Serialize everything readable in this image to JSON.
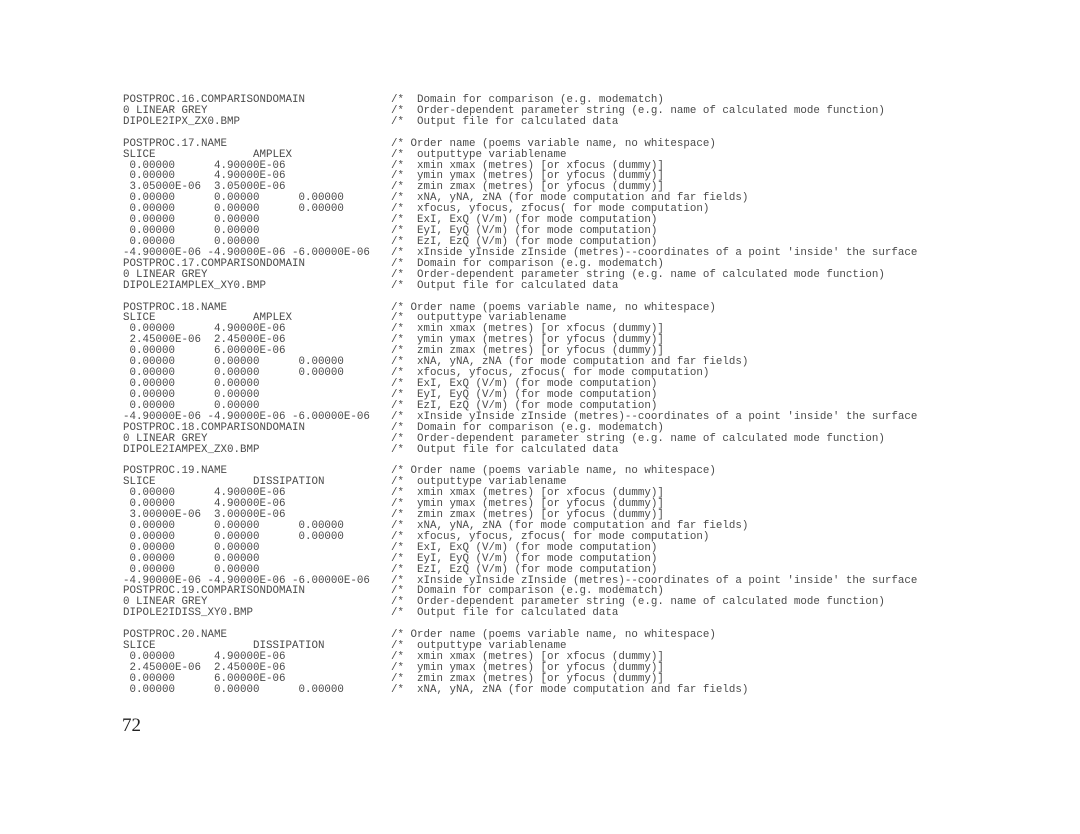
{
  "document": {
    "lines": [
      {
        "code": "POSTPROC.16.COMPARISONDOMAIN",
        "comment": "/*  Domain for comparison (e.g. modematch)"
      },
      {
        "code": "0 LINEAR GREY",
        "comment": "/*  Order-dependent parameter string (e.g. name of calculated mode function)"
      },
      {
        "code": "DIPOLE2IPX_ZX0.BMP",
        "comment": "/*  Output file for calculated data"
      },
      {
        "code": "",
        "comment": ""
      },
      {
        "code": "POSTPROC.17.NAME",
        "comment": "/* Order name (poems variable name, no whitespace)"
      },
      {
        "code": "SLICE               AMPLEX",
        "comment": "/*  outputtype variablename"
      },
      {
        "code": " 0.00000      4.90000E-06",
        "comment": "/*  xmin xmax (metres) [or xfocus (dummy)]"
      },
      {
        "code": " 0.00000      4.90000E-06",
        "comment": "/*  ymin ymax (metres) [or yfocus (dummy)]"
      },
      {
        "code": " 3.05000E-06  3.05000E-06",
        "comment": "/*  zmin zmax (metres) [or yfocus (dummy)]"
      },
      {
        "code": " 0.00000      0.00000      0.00000",
        "comment": "/*  xNA, yNA, zNA (for mode computation and far fields)"
      },
      {
        "code": " 0.00000      0.00000      0.00000",
        "comment": "/*  xfocus, yfocus, zfocus( for mode computation)"
      },
      {
        "code": " 0.00000      0.00000",
        "comment": "/*  ExI, ExQ (V/m) (for mode computation)"
      },
      {
        "code": " 0.00000      0.00000",
        "comment": "/*  EyI, EyQ (V/m) (for mode computation)"
      },
      {
        "code": " 0.00000      0.00000",
        "comment": "/*  EzI, EzQ (V/m) (for mode computation)"
      },
      {
        "code": "-4.90000E-06 -4.90000E-06 -6.00000E-06",
        "comment": "/*  xInside yInside zInside (metres)--coordinates of a point 'inside' the surface"
      },
      {
        "code": "POSTPROC.17.COMPARISONDOMAIN",
        "comment": "/*  Domain for comparison (e.g. modematch)"
      },
      {
        "code": "0 LINEAR GREY",
        "comment": "/*  Order-dependent parameter string (e.g. name of calculated mode function)"
      },
      {
        "code": "DIPOLE2IAMPLEX_XY0.BMP",
        "comment": "/*  Output file for calculated data"
      },
      {
        "code": "",
        "comment": ""
      },
      {
        "code": "POSTPROC.18.NAME",
        "comment": "/* Order name (poems variable name, no whitespace)"
      },
      {
        "code": "SLICE               AMPLEX",
        "comment": "/*  outputtype variablename"
      },
      {
        "code": " 0.00000      4.90000E-06",
        "comment": "/*  xmin xmax (metres) [or xfocus (dummy)]"
      },
      {
        "code": " 2.45000E-06  2.45000E-06",
        "comment": "/*  ymin ymax (metres) [or yfocus (dummy)]"
      },
      {
        "code": " 0.00000      6.00000E-06",
        "comment": "/*  zmin zmax (metres) [or yfocus (dummy)]"
      },
      {
        "code": " 0.00000      0.00000      0.00000",
        "comment": "/*  xNA, yNA, zNA (for mode computation and far fields)"
      },
      {
        "code": " 0.00000      0.00000      0.00000",
        "comment": "/*  xfocus, yfocus, zfocus( for mode computation)"
      },
      {
        "code": " 0.00000      0.00000",
        "comment": "/*  ExI, ExQ (V/m) (for mode computation)"
      },
      {
        "code": " 0.00000      0.00000",
        "comment": "/*  EyI, EyQ (V/m) (for mode computation)"
      },
      {
        "code": " 0.00000      0.00000",
        "comment": "/*  EzI, EzQ (V/m) (for mode computation)"
      },
      {
        "code": "-4.90000E-06 -4.90000E-06 -6.00000E-06",
        "comment": "/*  xInside yInside zInside (metres)--coordinates of a point 'inside' the surface"
      },
      {
        "code": "POSTPROC.18.COMPARISONDOMAIN",
        "comment": "/*  Domain for comparison (e.g. modematch)"
      },
      {
        "code": "0 LINEAR GREY",
        "comment": "/*  Order-dependent parameter string (e.g. name of calculated mode function)"
      },
      {
        "code": "DIPOLE2IAMPEX_ZX0.BMP",
        "comment": "/*  Output file for calculated data"
      },
      {
        "code": "",
        "comment": ""
      },
      {
        "code": "POSTPROC.19.NAME",
        "comment": "/* Order name (poems variable name, no whitespace)"
      },
      {
        "code": "SLICE               DISSIPATION",
        "comment": "/*  outputtype variablename"
      },
      {
        "code": " 0.00000      4.90000E-06",
        "comment": "/*  xmin xmax (metres) [or xfocus (dummy)]"
      },
      {
        "code": " 0.00000      4.90000E-06",
        "comment": "/*  ymin ymax (metres) [or yfocus (dummy)]"
      },
      {
        "code": " 3.00000E-06  3.00000E-06",
        "comment": "/*  zmin zmax (metres) [or yfocus (dummy)]"
      },
      {
        "code": " 0.00000      0.00000      0.00000",
        "comment": "/*  xNA, yNA, zNA (for mode computation and far fields)"
      },
      {
        "code": " 0.00000      0.00000      0.00000",
        "comment": "/*  xfocus, yfocus, zfocus( for mode computation)"
      },
      {
        "code": " 0.00000      0.00000",
        "comment": "/*  ExI, ExQ (V/m) (for mode computation)"
      },
      {
        "code": " 0.00000      0.00000",
        "comment": "/*  EyI, EyQ (V/m) (for mode computation)"
      },
      {
        "code": " 0.00000      0.00000",
        "comment": "/*  EzI, EzQ (V/m) (for mode computation)"
      },
      {
        "code": "-4.90000E-06 -4.90000E-06 -6.00000E-06",
        "comment": "/*  xInside yInside zInside (metres)--coordinates of a point 'inside' the surface"
      },
      {
        "code": "POSTPROC.19.COMPARISONDOMAIN",
        "comment": "/*  Domain for comparison (e.g. modematch)"
      },
      {
        "code": "0 LINEAR GREY",
        "comment": "/*  Order-dependent parameter string (e.g. name of calculated mode function)"
      },
      {
        "code": "DIPOLE2IDISS_XY0.BMP",
        "comment": "/*  Output file for calculated data"
      },
      {
        "code": "",
        "comment": ""
      },
      {
        "code": "POSTPROC.20.NAME",
        "comment": "/* Order name (poems variable name, no whitespace)"
      },
      {
        "code": "SLICE               DISSIPATION",
        "comment": "/*  outputtype variablename"
      },
      {
        "code": " 0.00000      4.90000E-06",
        "comment": "/*  xmin xmax (metres) [or xfocus (dummy)]"
      },
      {
        "code": " 2.45000E-06  2.45000E-06",
        "comment": "/*  ymin ymax (metres) [or yfocus (dummy)]"
      },
      {
        "code": " 0.00000      6.00000E-06",
        "comment": "/*  zmin zmax (metres) [or yfocus (dummy)]"
      },
      {
        "code": " 0.00000      0.00000      0.00000",
        "comment": "/*  xNA, yNA, zNA (for mode computation and far fields)"
      }
    ],
    "page_number": "72"
  }
}
